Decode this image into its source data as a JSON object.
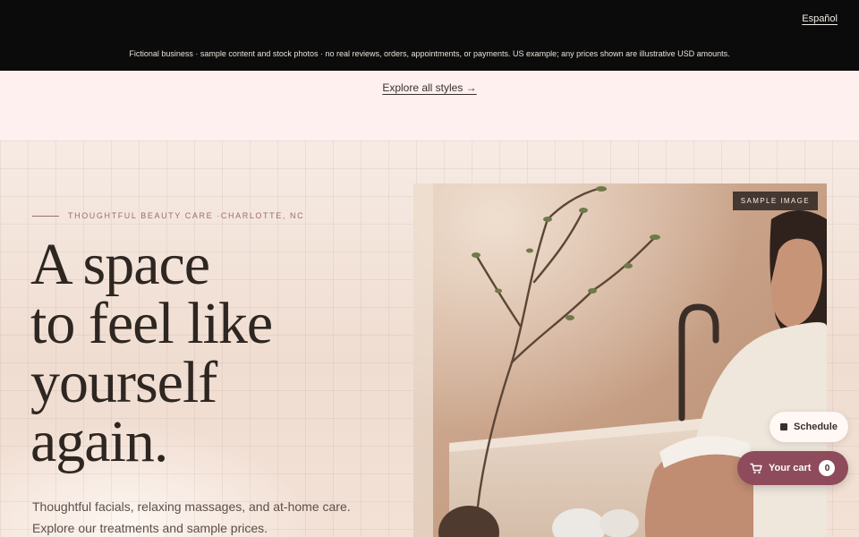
{
  "topbar": {
    "language_link": "Español",
    "disclaimer": "Fictional business · sample content and stock photos · no real reviews, orders, appointments, or payments. US example; any prices shown are illustrative USD amounts."
  },
  "explore": {
    "link_label": "Explore all styles →"
  },
  "hero": {
    "eyebrow": "THOUGHTFUL BEAUTY CARE ·CHARLOTTE, NC",
    "headline_lines": [
      "A space",
      "to feel like",
      "yourself",
      "again."
    ],
    "lede_lines": [
      "Thoughtful facials, relaxing massages, and at-home care.",
      "Explore our treatments and sample prices."
    ],
    "image_tag": "SAMPLE IMAGE"
  },
  "floating": {
    "schedule_label": "Schedule",
    "cart_label": "Your cart",
    "cart_count": "0",
    "cart_color": "#8e4b5c"
  },
  "icons": {
    "schedule": "square-icon",
    "cart": "cart-icon"
  }
}
